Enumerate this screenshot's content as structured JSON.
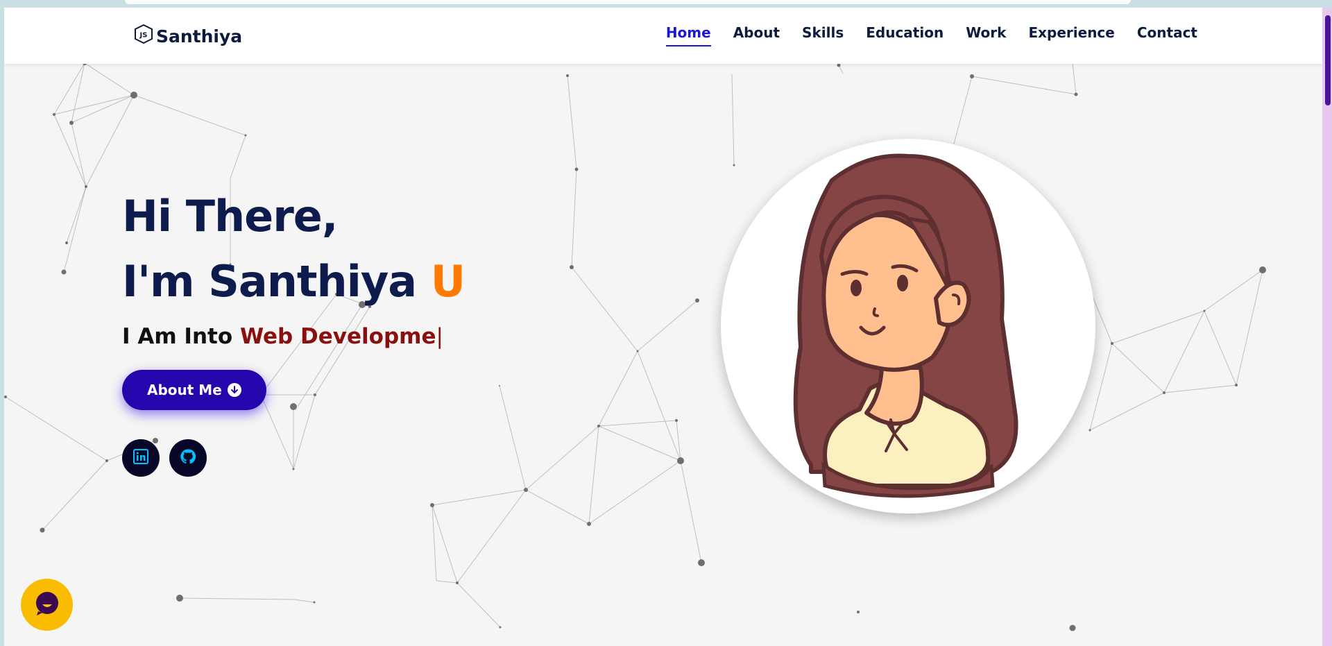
{
  "brand": {
    "name": "Santhiya",
    "logo_icon": "js-logo-icon"
  },
  "nav": {
    "items": [
      {
        "label": "Home",
        "active": true
      },
      {
        "label": "About",
        "active": false
      },
      {
        "label": "Skills",
        "active": false
      },
      {
        "label": "Education",
        "active": false
      },
      {
        "label": "Work",
        "active": false
      },
      {
        "label": "Experience",
        "active": false
      },
      {
        "label": "Contact",
        "active": false
      }
    ]
  },
  "hero": {
    "greeting": "Hi There,",
    "intro": "I'm Santhiya",
    "initial": "U",
    "typing_prefix": "I Am Into",
    "typing_role": "Web Developme",
    "cursor": "|",
    "about_button": "About Me",
    "socials": [
      {
        "icon": "linkedin-icon"
      },
      {
        "icon": "github-icon"
      }
    ]
  },
  "colors": {
    "heading": "#0d1b4d",
    "accent_orange": "#ff7a00",
    "role_red": "#8a1010",
    "button_blue": "#2506ad",
    "nav_active": "#1c16d8",
    "chat_yellow": "#f9bc00"
  },
  "chat_widget": {
    "icon": "chat-icon"
  }
}
